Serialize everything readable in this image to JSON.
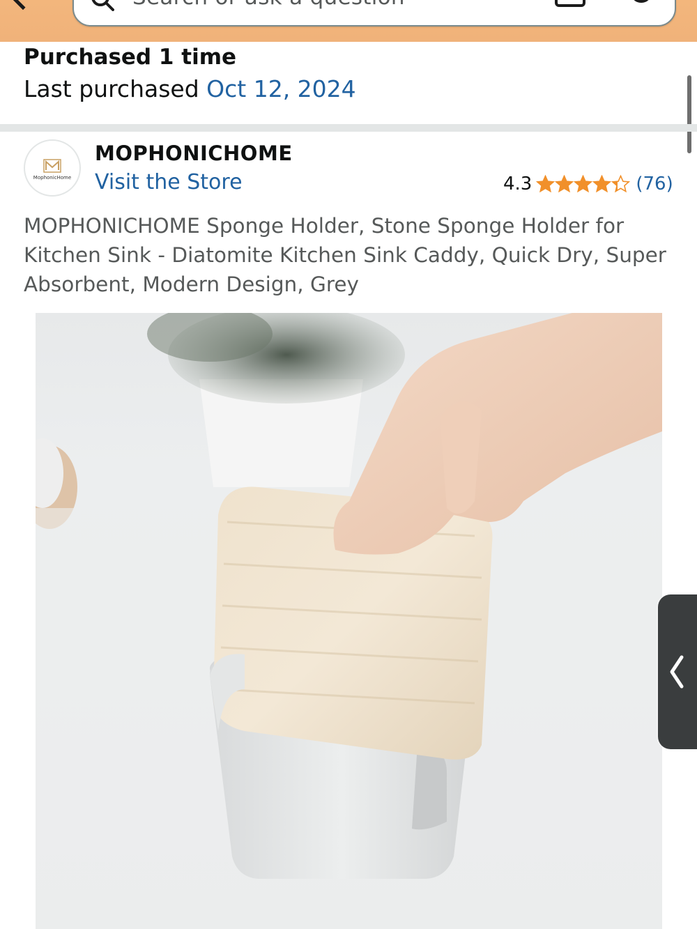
{
  "header": {
    "search_placeholder": "Search or ask a question"
  },
  "purchase": {
    "count_text": "Purchased 1 time",
    "last_label": "Last purchased ",
    "last_date": "Oct 12, 2024"
  },
  "brand": {
    "logo_text": "MophonicHome",
    "name": "MOPHONICHOME",
    "visit_store": "Visit the Store"
  },
  "rating": {
    "value": "4.3",
    "stars": 4.3,
    "count": "(76)"
  },
  "product": {
    "title": "MOPHONICHOME Sponge Holder, Stone Sponge Holder for Kitchen Sink - Diatomite Kitchen Sink Caddy, Quick Dry, Super Absorbent, Modern Design, Grey"
  },
  "colors": {
    "header_bg": "#f0b27a",
    "link": "#2162a1",
    "star": "#f1902a",
    "text": "#0f1111",
    "secondary_text": "#565959"
  },
  "icons": [
    "back-chevron-icon",
    "search-icon",
    "camera-icon",
    "microphone-icon",
    "star-icon",
    "chevron-left-icon"
  ]
}
